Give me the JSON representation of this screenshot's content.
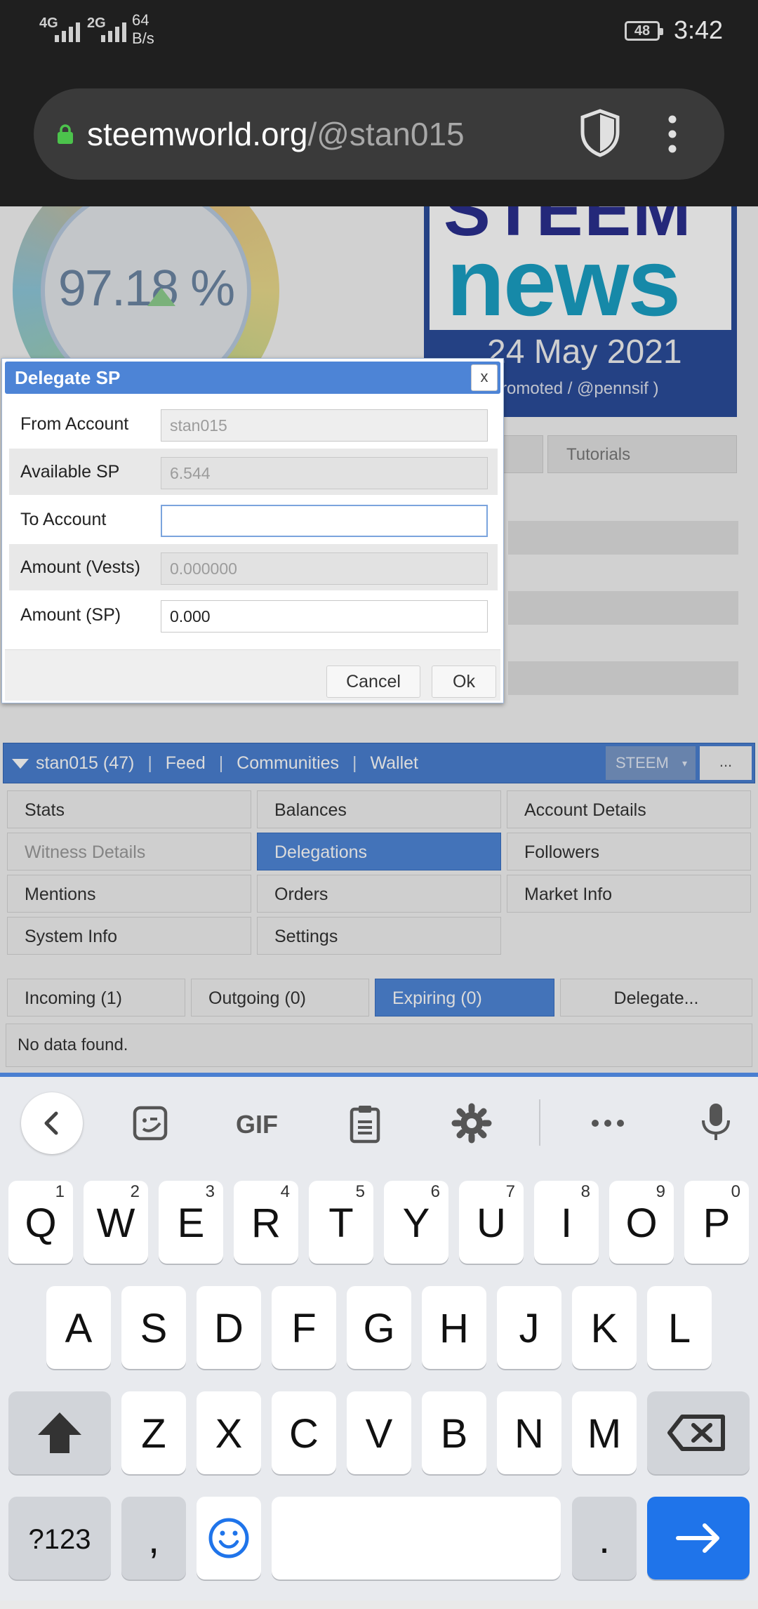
{
  "status_bar": {
    "network1": "4G",
    "network2": "2G",
    "speed_value": "64",
    "speed_unit": "B/s",
    "battery": "48",
    "time": "3:42"
  },
  "browser": {
    "url_domain": "steemworld.org",
    "url_path": "/@stan015",
    "lock_icon": "lock-icon",
    "shield_icon": "shield-icon",
    "menu_icon": "more-vert-icon"
  },
  "page": {
    "gauge_value": "97.18 %",
    "news": {
      "brand_top": "STEEM",
      "brand_bottom": "news",
      "date": "24 May 2021",
      "sub": "romoted / @pennsif )"
    },
    "bg_tab": "Tutorials",
    "user_bar": {
      "account": "stan015 (47)",
      "links": [
        "Feed",
        "Communities",
        "Wallet"
      ],
      "separator": "|",
      "currency": "STEEM",
      "more": "..."
    },
    "nav_buttons": [
      [
        "Stats",
        "Balances",
        "Account Details"
      ],
      [
        "Witness Details",
        "Delegations",
        "Followers"
      ],
      [
        "Mentions",
        "Orders",
        "Market Info"
      ],
      [
        "System Info",
        "Settings",
        ""
      ]
    ],
    "sub_tabs": [
      "Incoming (1)",
      "Outgoing (0)",
      "Expiring (0)",
      "Delegate..."
    ],
    "no_data": "No data found."
  },
  "dialog": {
    "title": "Delegate SP",
    "close": "x",
    "rows": [
      {
        "label": "From Account",
        "value": "stan015"
      },
      {
        "label": "Available SP",
        "value": "6.544"
      },
      {
        "label": "To Account",
        "value": ""
      },
      {
        "label": "Amount (Vests)",
        "value": "0.000000"
      },
      {
        "label": "Amount (SP)",
        "value": "0.000"
      }
    ],
    "cancel": "Cancel",
    "ok": "Ok"
  },
  "keyboard": {
    "toolbar": [
      "back-icon",
      "sticker-icon",
      "gif-icon",
      "clipboard-icon",
      "settings-icon",
      "more-horiz-icon",
      "mic-icon"
    ],
    "gif_label": "GIF",
    "row1": [
      {
        "k": "Q",
        "s": "1"
      },
      {
        "k": "W",
        "s": "2"
      },
      {
        "k": "E",
        "s": "3"
      },
      {
        "k": "R",
        "s": "4"
      },
      {
        "k": "T",
        "s": "5"
      },
      {
        "k": "Y",
        "s": "6"
      },
      {
        "k": "U",
        "s": "7"
      },
      {
        "k": "I",
        "s": "8"
      },
      {
        "k": "O",
        "s": "9"
      },
      {
        "k": "P",
        "s": "0"
      }
    ],
    "row2": [
      "A",
      "S",
      "D",
      "F",
      "G",
      "H",
      "J",
      "K",
      "L"
    ],
    "row3": [
      "Z",
      "X",
      "C",
      "V",
      "B",
      "N",
      "M"
    ],
    "symbols": "?123",
    "comma": ",",
    "period": "."
  }
}
